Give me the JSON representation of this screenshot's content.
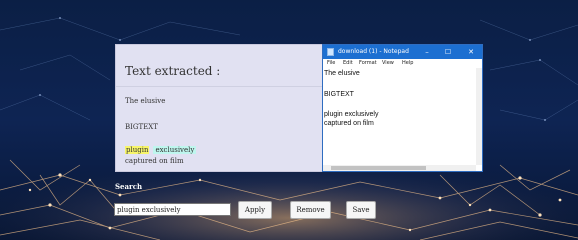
{
  "panel": {
    "title": "Text extracted :",
    "line1": "The elusive",
    "line2": "BIGTEXT",
    "highlight1": "plugin",
    "highlight2": "exclusively",
    "line4": "captured on film"
  },
  "notepad": {
    "title": "download (1) - Notepad",
    "menu": [
      "File",
      "Edit",
      "Format",
      "View",
      "Help"
    ],
    "lines": [
      "The elusive",
      "BIGTEXT",
      "plugin exclusively",
      "captured on film"
    ],
    "controls": {
      "minimize": "–",
      "maximize": "☐",
      "close": "✕"
    }
  },
  "search": {
    "label": "Search",
    "value": "plugin exclusively",
    "buttons": {
      "apply": "Apply",
      "remove": "Remove",
      "save": "Save"
    }
  },
  "colors": {
    "panel_bg": "#e1e1f2",
    "highlight_yellow": "#f7f56a",
    "highlight_cyan": "#bff6ee",
    "notepad_titlebar": "#1c6fd1"
  }
}
